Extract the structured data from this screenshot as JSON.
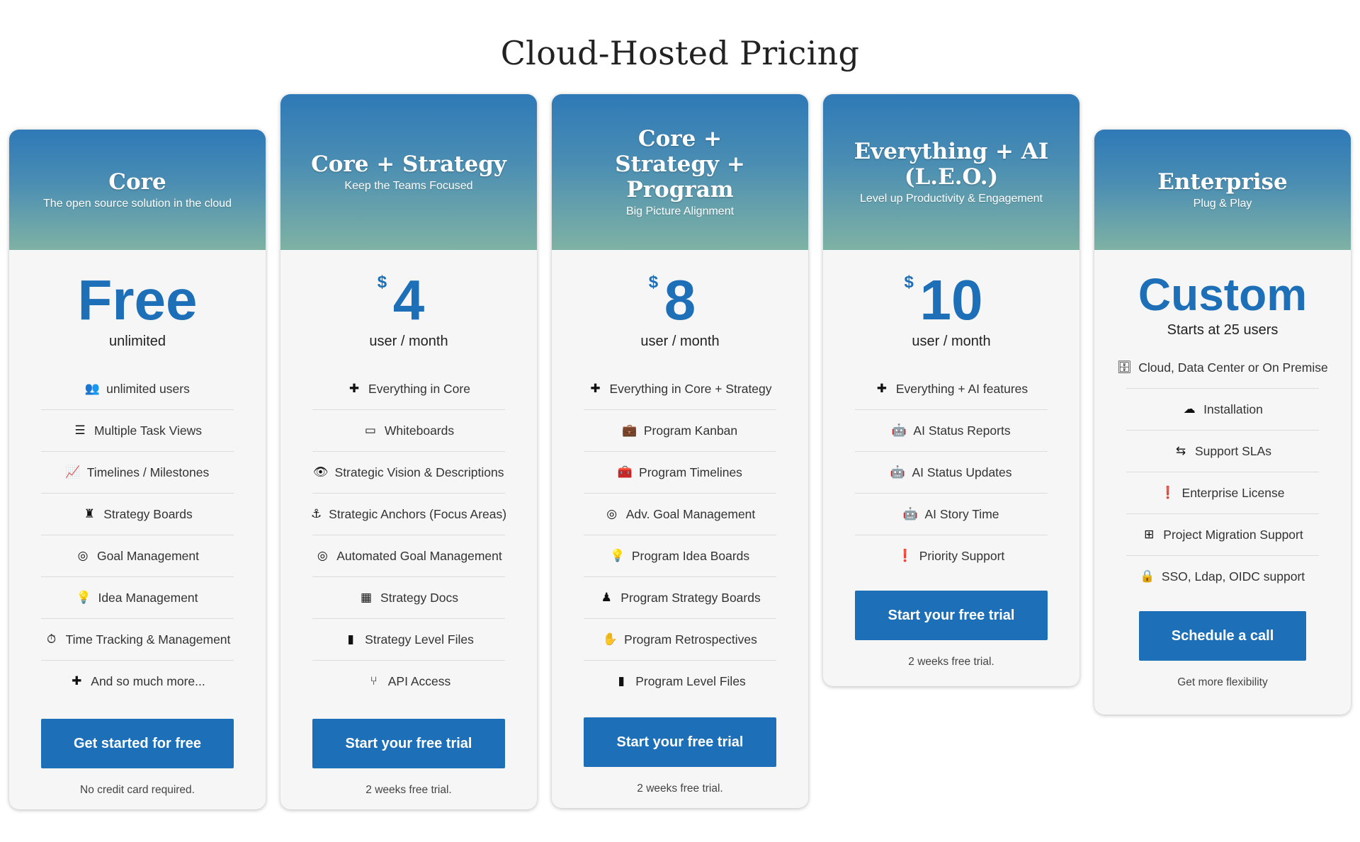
{
  "title": "Cloud-Hosted Pricing",
  "plans": [
    {
      "name": "Core",
      "tagline": "The open source solution in the cloud",
      "currency": "",
      "price": "Free",
      "period": "unlimited",
      "features": [
        {
          "icon": "users-icon",
          "glyph": "👥",
          "text": "unlimited users"
        },
        {
          "icon": "list-icon",
          "glyph": "☰",
          "text": "Multiple Task Views"
        },
        {
          "icon": "chart-line-icon",
          "glyph": "📈",
          "text": "Timelines / Milestones"
        },
        {
          "icon": "chess-icon",
          "glyph": "♜",
          "text": "Strategy Boards"
        },
        {
          "icon": "target-icon",
          "glyph": "◎",
          "text": "Goal Management"
        },
        {
          "icon": "lightbulb-icon",
          "glyph": "💡",
          "text": "Idea Management"
        },
        {
          "icon": "stopwatch-icon",
          "glyph": "⏱",
          "text": "Time Tracking & Management"
        },
        {
          "icon": "plus-icon",
          "glyph": "✚",
          "text": "And so much more..."
        }
      ],
      "cta": "Get started for free",
      "note": "No credit card required."
    },
    {
      "name": "Core + Strategy",
      "tagline": "Keep the Teams Focused",
      "currency": "$",
      "price": "4",
      "period": "user / month",
      "features": [
        {
          "icon": "plus-icon",
          "glyph": "✚",
          "text": "Everything in Core"
        },
        {
          "icon": "whiteboard-icon",
          "glyph": "▭",
          "text": "Whiteboards"
        },
        {
          "icon": "eye-icon",
          "glyph": "👁",
          "text": "Strategic Vision & Descriptions"
        },
        {
          "icon": "anchor-icon",
          "glyph": "⚓",
          "text": "Strategic Anchors (Focus Areas)"
        },
        {
          "icon": "target-icon",
          "glyph": "◎",
          "text": "Automated Goal Management"
        },
        {
          "icon": "calendar-icon",
          "glyph": "▦",
          "text": "Strategy Docs"
        },
        {
          "icon": "file-icon",
          "glyph": "▮",
          "text": "Strategy Level Files"
        },
        {
          "icon": "code-branch-icon",
          "glyph": "⑂",
          "text": "API Access"
        }
      ],
      "cta": "Start your free trial",
      "note": "2 weeks free trial."
    },
    {
      "name": "Core + Strategy + Program",
      "tagline": "Big Picture Alignment",
      "currency": "$",
      "price": "8",
      "period": "user / month",
      "features": [
        {
          "icon": "plus-icon",
          "glyph": "✚",
          "text": "Everything in Core + Strategy"
        },
        {
          "icon": "briefcase-icon",
          "glyph": "💼",
          "text": "Program Kanban"
        },
        {
          "icon": "toolbox-icon",
          "glyph": "🧰",
          "text": "Program Timelines"
        },
        {
          "icon": "target-icon",
          "glyph": "◎",
          "text": "Adv. Goal Management"
        },
        {
          "icon": "lightbulb-outline-icon",
          "glyph": "💡",
          "text": "Program Idea Boards"
        },
        {
          "icon": "chess-pawn-icon",
          "glyph": "♟",
          "text": "Program Strategy Boards"
        },
        {
          "icon": "hand-icon",
          "glyph": "✋",
          "text": "Program Retrospectives"
        },
        {
          "icon": "file-icon",
          "glyph": "▮",
          "text": "Program Level Files"
        }
      ],
      "cta": "Start your free trial",
      "note": "2 weeks free trial."
    },
    {
      "name": "Everything + AI (L.E.O.)",
      "tagline": "Level up Productivity & Engagement",
      "currency": "$",
      "price": "10",
      "period": "user / month",
      "features": [
        {
          "icon": "plus-icon",
          "glyph": "✚",
          "text": "Everything + AI features"
        },
        {
          "icon": "robot-icon",
          "glyph": "🤖",
          "text": "AI Status Reports"
        },
        {
          "icon": "robot-icon",
          "glyph": "🤖",
          "text": "AI Status Updates"
        },
        {
          "icon": "robot-icon",
          "glyph": "🤖",
          "text": "AI Story Time"
        },
        {
          "icon": "exclamation-circle-icon",
          "glyph": "❗",
          "text": "Priority Support"
        }
      ],
      "cta": "Start your free trial",
      "note": "2 weeks free trial."
    },
    {
      "name": "Enterprise",
      "tagline": "Plug & Play",
      "currency": "",
      "price": "Custom",
      "period": "Starts at 25 users",
      "features": [
        {
          "icon": "database-icon",
          "glyph": "🗄",
          "text": "Cloud, Data Center or On Premise"
        },
        {
          "icon": "cloud-upload-icon",
          "glyph": "☁",
          "text": "Installation"
        },
        {
          "icon": "people-arrows-icon",
          "glyph": "⇆",
          "text": "Support SLAs"
        },
        {
          "icon": "exclamation-circle-icon",
          "glyph": "❗",
          "text": "Enterprise License"
        },
        {
          "icon": "briefcase-medical-icon",
          "glyph": "⊞",
          "text": "Project Migration Support"
        },
        {
          "icon": "user-lock-icon",
          "glyph": "🔒",
          "text": "SSO, Ldap, OIDC support"
        }
      ],
      "cta": "Schedule a call",
      "note": "Get more flexibility"
    }
  ]
}
